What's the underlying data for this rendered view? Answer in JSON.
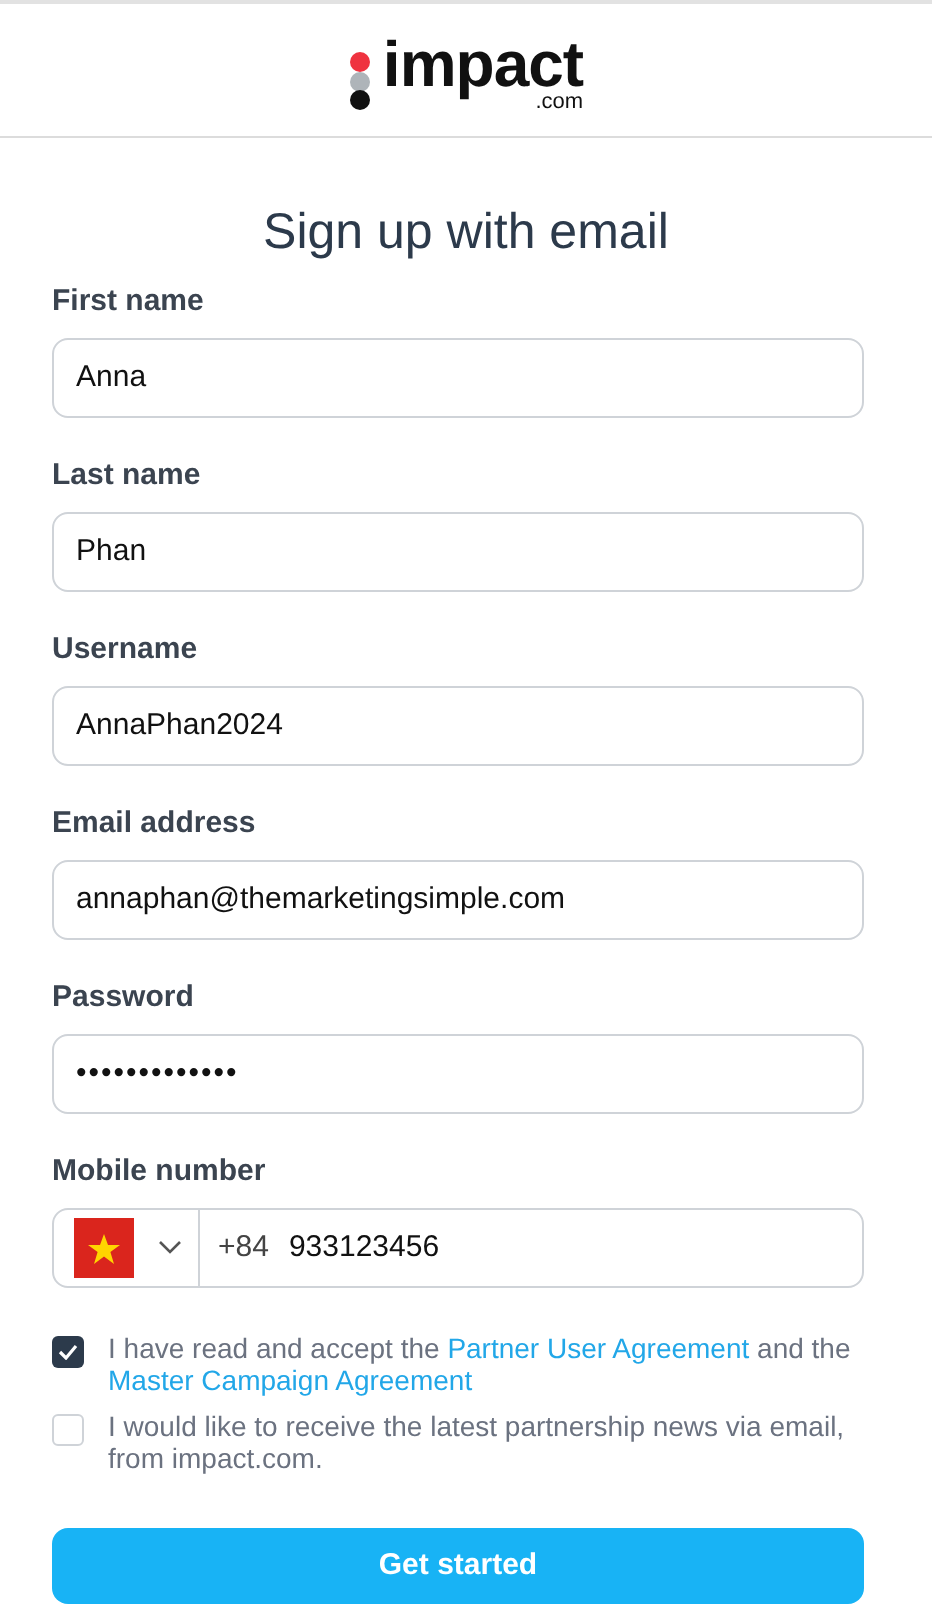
{
  "logo": {
    "name": "impact",
    "suffix": ".com"
  },
  "title": "Sign up with email",
  "fields": [
    {
      "label": "First name",
      "value": "Anna",
      "kind": "text"
    },
    {
      "label": "Last name",
      "value": "Phan",
      "kind": "text"
    },
    {
      "label": "Username",
      "value": "AnnaPhan2024",
      "kind": "text"
    },
    {
      "label": "Email address",
      "value": "annaphan@themarketingsimple.com",
      "kind": "text"
    },
    {
      "label": "Password",
      "value": "•••••••••••••",
      "kind": "password"
    },
    {
      "label": "Mobile number",
      "value": "933123456",
      "code": "+84",
      "kind": "phone"
    }
  ],
  "consents": [
    {
      "checked": true,
      "parts": [
        {
          "kind": "text",
          "text": "I have read and accept the "
        },
        {
          "kind": "link",
          "text": "Partner User Agreement"
        },
        {
          "kind": "text",
          "text": " and the "
        },
        {
          "kind": "link",
          "text": "Master Campaign Agreement"
        }
      ]
    },
    {
      "checked": false,
      "parts": [
        {
          "kind": "text",
          "text": "I would like to receive the latest partnership news via email, from impact.com."
        }
      ]
    }
  ],
  "submit": "Get started"
}
